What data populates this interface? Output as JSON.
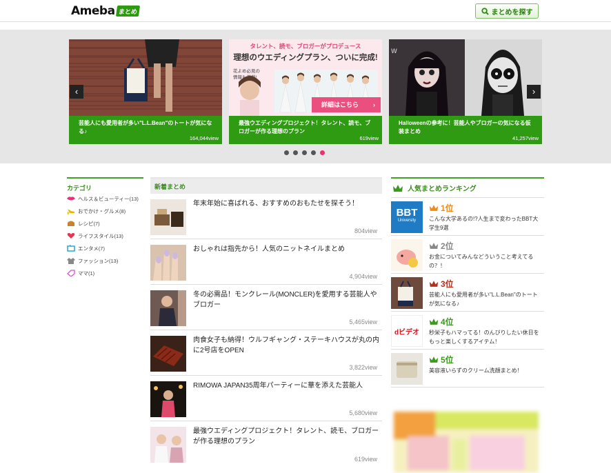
{
  "header": {
    "logo_text": "Ameba",
    "logo_badge": "まとめ",
    "search_label": "まとめを探す"
  },
  "hero": {
    "slides": [
      {
        "caption": "芸能人にも愛用者が多い\"L.L.Bean\"のトートが気になる♪",
        "views": "164,044view"
      },
      {
        "caption": "最強ウエディングプロジェクト！タレント、読モ、ブロガーが作る理想のプラン",
        "views": "619view"
      },
      {
        "caption": "Halloweenの参考に！芸能人やブロガーの気になる仮装まとめ",
        "views": "41,257view"
      }
    ],
    "promo": {
      "top": "タレント、読モ、ブロガーがプロデュース",
      "main": "理想のウエディングプラン、ついに完成!",
      "side1": "花よめ必見の",
      "side2": "情報も満載!",
      "button": "詳細はこちら"
    },
    "active_dot": 4,
    "dot_count": 5
  },
  "categories": {
    "title": "カテゴリ",
    "items": [
      {
        "label": "ヘルス＆ビューティー(13)",
        "icon": "lips-icon"
      },
      {
        "label": "おでかけ・グルメ(8)",
        "icon": "heel-icon"
      },
      {
        "label": "レシピ(7)",
        "icon": "bread-icon"
      },
      {
        "label": "ライフスタイル(13)",
        "icon": "heart-icon"
      },
      {
        "label": "エンタメ(7)",
        "icon": "tv-icon"
      },
      {
        "label": "ファッション(13)",
        "icon": "clothes-icon"
      },
      {
        "label": "ママ(1)",
        "icon": "tag-icon"
      }
    ]
  },
  "new_articles": {
    "title": "新着まとめ",
    "items": [
      {
        "title": "年末年始に喜ばれる、おすすめのおもたせを探そう！",
        "views": "804view"
      },
      {
        "title": "おしゃれは指先から！人気のニットネイルまとめ",
        "views": "4,904view"
      },
      {
        "title": "冬の必需品！モンクレール(MONCLER)を愛用する芸能人やブロガー",
        "views": "5,465view"
      },
      {
        "title": "肉食女子も納得！ウルフギャング・ステーキハウスが丸の内に2号店をOPEN",
        "views": "3,822view"
      },
      {
        "title": "RIMOWA JAPAN35周年パーティーに華を添えた芸能人",
        "views": "5,680view"
      },
      {
        "title": "最強ウエディングプロジェクト！タレント、読モ、ブロガーが作る理想のプラン",
        "views": "619view"
      }
    ]
  },
  "ranking": {
    "title": "人気まとめランキング",
    "items": [
      {
        "rank": "1位",
        "text": "こんな大学あるの!?人生まで変わったBBT大学生9選",
        "color": "#f08a18",
        "thumb_label": "BBT",
        "thumb_sub": "University"
      },
      {
        "rank": "2位",
        "text": "お金についてみんなどういうこと考えてるの？！",
        "color": "#888888"
      },
      {
        "rank": "3位",
        "text": "芸能人にも愛用者が多い\"L.L.Bean\"のトートが気になる♪",
        "color": "#b0321e"
      },
      {
        "rank": "4位",
        "text": "秒栄子もハマってる！のんびりしたい休日をもっと楽しくするアイテム！",
        "color": "#3a9a1e",
        "thumb_label": "dビデオ"
      },
      {
        "rank": "5位",
        "text": "美容液いらずのクリーム洗顔まとめ！",
        "color": "#3a9a1e"
      }
    ]
  },
  "colors": {
    "brand_green": "#2e9b13",
    "active_dot": "#e8336b"
  }
}
